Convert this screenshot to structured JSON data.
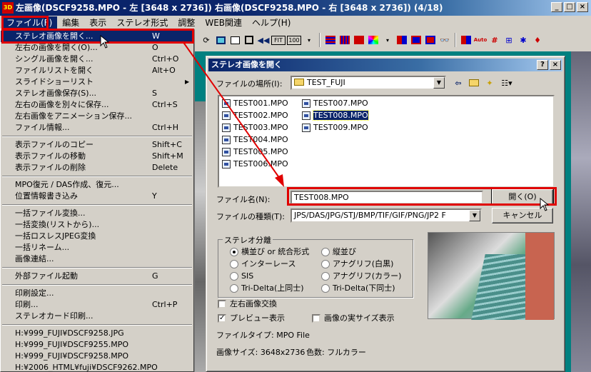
{
  "app": {
    "title": "左画像(DSCF9258.MPO - 左 [3648 x 2736]) 右画像(DSCF9258.MPO - 右 [3648 x 2736])  (4/18)",
    "icon_text": "3D"
  },
  "window_buttons": {
    "minimize": "_",
    "maximize": "□",
    "close": "×"
  },
  "menubar": [
    "ファイル(F)",
    "編集",
    "表示",
    "ステレオ形式",
    "調整",
    "WEB関連",
    "ヘルプ(H)"
  ],
  "file_menu": [
    {
      "label": "ステレオ画像を開く...",
      "shortcut": "W",
      "highlight": true
    },
    {
      "label": "左右の画像を開く(O)...",
      "shortcut": "O"
    },
    {
      "label": "シングル画像を開く...",
      "shortcut": "Ctrl+O"
    },
    {
      "label": "ファイルリストを開く",
      "shortcut": "Alt+O"
    },
    {
      "label": "スライドショーリスト",
      "shortcut": "",
      "submenu": true
    },
    {
      "label": "ステレオ画像保存(S)...",
      "shortcut": "S"
    },
    {
      "label": "左右の画像を別々に保存...",
      "shortcut": "Ctrl+S"
    },
    {
      "label": "左右画像をアニメーション保存...",
      "shortcut": ""
    },
    {
      "label": "ファイル情報...",
      "shortcut": "Ctrl+H"
    },
    {
      "separator": true
    },
    {
      "label": "表示ファイルのコピー",
      "shortcut": "Shift+C"
    },
    {
      "label": "表示ファイルの移動",
      "shortcut": "Shift+M"
    },
    {
      "label": "表示ファイルの削除",
      "shortcut": "Delete"
    },
    {
      "separator": true
    },
    {
      "label": "MPO復元 / DAS作成、復元...",
      "shortcut": ""
    },
    {
      "label": "位置情報書き込み",
      "shortcut": "Y"
    },
    {
      "separator": true
    },
    {
      "label": "一括ファイル変換...",
      "shortcut": ""
    },
    {
      "label": "一括変換(リストから)...",
      "shortcut": ""
    },
    {
      "label": "一括ロスレスJPEG変換",
      "shortcut": ""
    },
    {
      "label": "一括リネーム...",
      "shortcut": ""
    },
    {
      "label": "画像連結...",
      "shortcut": ""
    },
    {
      "separator": true
    },
    {
      "label": "外部ファイル起動",
      "shortcut": "G"
    },
    {
      "separator": true
    },
    {
      "label": "印刷設定...",
      "shortcut": ""
    },
    {
      "label": "印刷...",
      "shortcut": "Ctrl+P"
    },
    {
      "label": "ステレオカード印刷...",
      "shortcut": ""
    },
    {
      "separator": true
    },
    {
      "label": "H:¥999_FUJI¥DSCF9258.JPG",
      "shortcut": ""
    },
    {
      "label": "H:¥999_FUJI¥DSCF9255.MPO",
      "shortcut": ""
    },
    {
      "label": "H:¥999_FUJI¥DSCF9258.MPO",
      "shortcut": ""
    },
    {
      "label": "H:¥2006_HTML¥fuji¥DSCF9262.MPO",
      "shortcut": ""
    }
  ],
  "dialog": {
    "title": "ステレオ画像を開く",
    "help_button": "?",
    "close_button": "×",
    "look_in_label": "ファイルの場所(I):",
    "look_in_value": "TEST_FUJI",
    "files": [
      "TEST001.MPO",
      "TEST002.MPO",
      "TEST003.MPO",
      "TEST004.MPO",
      "TEST005.MPO",
      "TEST006.MPO",
      "TEST007.MPO",
      "TEST008.MPO",
      "TEST009.MPO"
    ],
    "selected_file": "TEST008.MPO",
    "filename_label": "ファイル名(N):",
    "filename_value": "TEST008.MPO",
    "filetype_label": "ファイルの種類(T):",
    "filetype_value": "JPS/DAS/JPG/STJ/BMP/TIF/GIF/PNG/JP2 F",
    "open_button": "開く(O)",
    "cancel_button": "キャンセル",
    "stereo_group_title": "ステレオ分離",
    "radios": [
      {
        "label": "横並び or 統合形式",
        "checked": true
      },
      {
        "label": "縦並び",
        "checked": false
      },
      {
        "label": "インターレース",
        "checked": false
      },
      {
        "label": "アナグリフ(白黒)",
        "checked": false
      },
      {
        "label": "SIS",
        "checked": false
      },
      {
        "label": "アナグリフ(カラー)",
        "checked": false
      },
      {
        "label": "Tri-Delta(上同士)",
        "checked": false
      },
      {
        "label": "Tri-Delta(下同士)",
        "checked": false
      }
    ],
    "swap_lr_label": "左右画像交換",
    "swap_lr_checked": false,
    "preview_label": "プレビュー表示",
    "preview_checked": true,
    "actual_size_label": "画像の実サイズ表示",
    "actual_size_checked": false,
    "filetype_info": "ファイルタイプ: MPO File",
    "image_size_info": "画像サイズ: 3648x2736",
    "color_info": "色数: フルカラー"
  },
  "toolbar_texts": {
    "fit": "FIT",
    "hundred": "100",
    "auto": "Auto"
  },
  "colors": {
    "titlebar": "#0a246a",
    "highlight": "#0a246a",
    "annotation_red": "#e00000",
    "background": "#008080"
  }
}
